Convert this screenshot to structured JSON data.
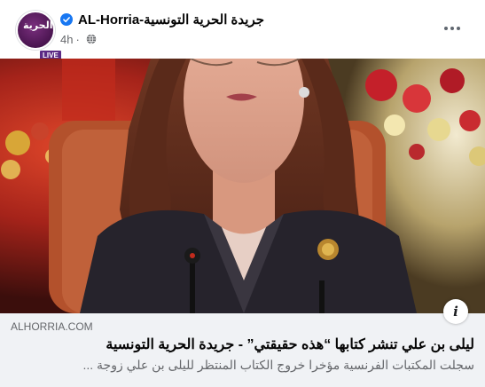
{
  "post": {
    "page_name": "AL-Horria-جريدة الحرية التونسية",
    "time": "4h",
    "separator": "·",
    "avatar_text": "الحرية",
    "live_badge": "LIVE",
    "verified_icon": "verified-badge-icon",
    "audience_icon": "globe-icon",
    "more_icon": "more-options-icon"
  },
  "link": {
    "domain": "ALHORRIA.COM",
    "title": "ليلى بن علي تنشر كتابها “هذه حقيقتي” - جريدة الحرية التونسية",
    "description": "سجلت المكتبات الفرنسية مؤخرا خروج الكتاب المنتظر لليلى بن علي زوجة ...",
    "info_icon": "info-icon"
  },
  "colors": {
    "verified": "#1877f2",
    "preview_bg": "#f0f2f5",
    "secondary_text": "#65676b"
  }
}
